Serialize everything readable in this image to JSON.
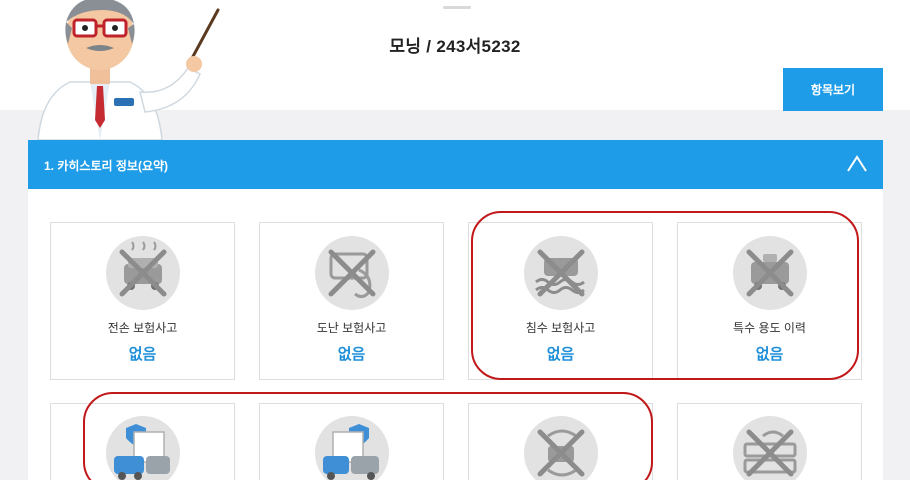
{
  "header": {
    "vehicle_title": "모닝 / 243서5232",
    "list_button_label": "항목보기"
  },
  "section": {
    "title": "1. 카히스토리 정보(요약)"
  },
  "tiles": [
    {
      "label": "전손 보험사고",
      "value": "없음",
      "icon": "car-total-loss-icon"
    },
    {
      "label": "도난 보험사고",
      "value": "없음",
      "icon": "car-theft-icon"
    },
    {
      "label": "침수 보험사고",
      "value": "없음",
      "icon": "car-flood-icon"
    },
    {
      "label": "특수 용도 이력",
      "value": "없음",
      "icon": "special-use-car-icon"
    }
  ],
  "colors": {
    "accent": "#1e9ce8",
    "value_text": "#1e8fd8",
    "highlight_circle": "#c2181a"
  }
}
